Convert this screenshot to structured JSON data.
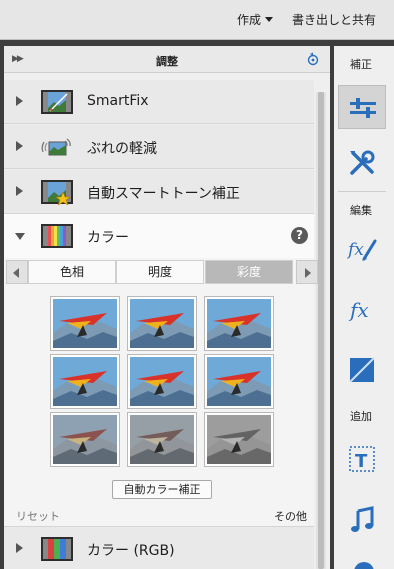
{
  "topbar": {
    "create_label": "作成",
    "share_label": "書き出しと共有"
  },
  "panel": {
    "title": "調整",
    "rows": [
      {
        "label": "SmartFix"
      },
      {
        "label": "ぶれの軽減"
      },
      {
        "label": "自動スマートトーン補正"
      },
      {
        "label": "カラー"
      },
      {
        "label": "カラー (RGB)"
      }
    ],
    "help_label": "?",
    "tabs": [
      "色相",
      "明度",
      "彩度"
    ],
    "selected_tab": "彩度",
    "auto_color_button": "自動カラー補正",
    "reset_label": "リセット",
    "other_label": "その他"
  },
  "sidebar": {
    "correct_label": "補正",
    "edit_label": "編集",
    "add_label": "追加",
    "icons": [
      "adjust-sliders-icon",
      "tools-icon",
      "fx-brush-icon",
      "fx-icon",
      "frame-icon",
      "text-icon",
      "music-icon"
    ]
  },
  "colors": {
    "accent": "#2a6ebb",
    "panel_bg": "#efefef",
    "selected_tab": "#b8b8b8"
  },
  "grid": {
    "rows": 3,
    "cols": 3,
    "saturation_levels": [
      1,
      1,
      1,
      1,
      1,
      1,
      0.35,
      0.15,
      0
    ]
  }
}
